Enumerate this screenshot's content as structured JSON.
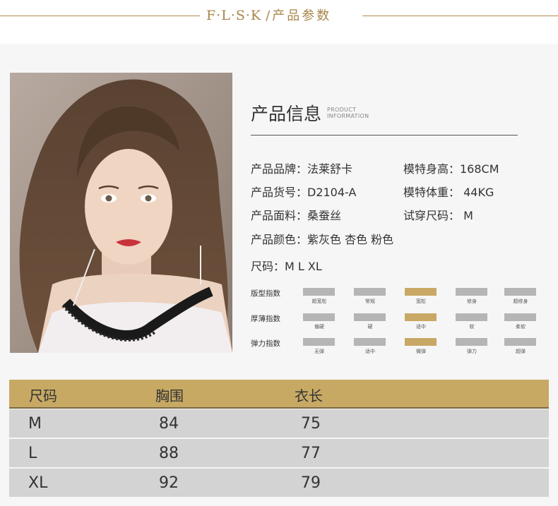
{
  "header": {
    "brand": "F·L·S·K",
    "subtitle": "/产品参数"
  },
  "info": {
    "title": "产品信息",
    "subtitle_line1": "PRODUCT",
    "subtitle_line2": "INFORMATION",
    "specs": {
      "brand": "产品品牌：法莱舒卡",
      "model_height": "模特身高：168CM",
      "item_no": "产品货号：D2104-A",
      "model_weight": "模特体重： 44KG",
      "fabric": "产品面料：桑蚕丝",
      "fit_size": "试穿尺码： M",
      "colors": "产品颜色：紫灰色 杏色 粉色",
      "sizes": "尺码：M  L XL"
    },
    "indexes": [
      {
        "label": "版型指数",
        "options": [
          "超宽松",
          "常规",
          "宽松",
          "修身",
          "超修身"
        ],
        "selected": 2
      },
      {
        "label": "厚薄指数",
        "options": [
          "偏硬",
          "硬",
          "适中",
          "软",
          "柔软"
        ],
        "selected": 2
      },
      {
        "label": "弹力指数",
        "options": [
          "无弹",
          "适中",
          "微弹",
          "弹力",
          "超弹"
        ],
        "selected": 2
      }
    ]
  },
  "size_table": {
    "headers": [
      "尺码",
      "胸围",
      "衣长"
    ],
    "rows": [
      [
        "M",
        "84",
        "75"
      ],
      [
        "L",
        "88",
        "77"
      ],
      [
        "XL",
        "92",
        "79"
      ]
    ]
  },
  "colors": {
    "accent": "#c8a864",
    "brand": "#a8854a",
    "bar_gray": "#b5b5b5",
    "row_gray": "#d3d3d3"
  }
}
